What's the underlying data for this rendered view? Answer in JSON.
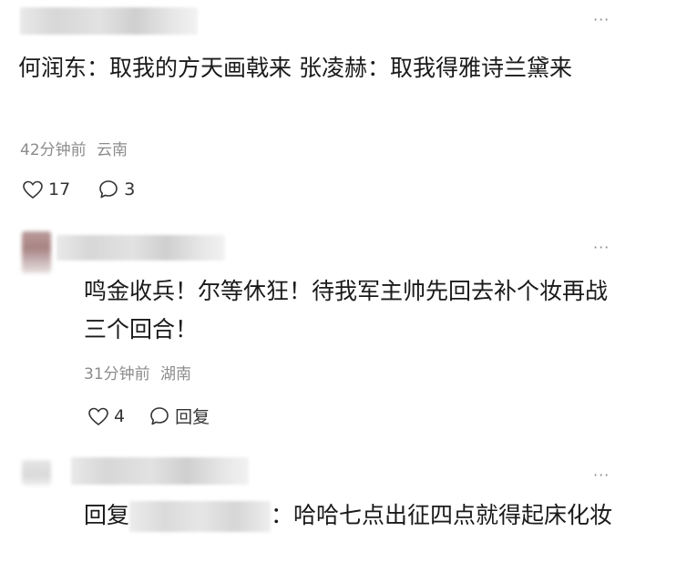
{
  "comments": [
    {
      "text": "何润东：取我的方天画戟来 张凌赫：取我得雅诗兰黛来",
      "time": "42分钟前",
      "location": "云南",
      "likes": "17",
      "replies": "3"
    },
    {
      "text": "鸣金收兵！尔等休狂！待我军主帅先回去补个妆再战三个回合！",
      "time": "31分钟前",
      "location": "湖南",
      "likes": "4",
      "reply_label": "回复"
    },
    {
      "reply_prefix": "回复",
      "text": "：哈哈七点出征四点就得起床化妆"
    }
  ],
  "icons": {
    "more": "more-dots-icon",
    "like": "heart-outline-icon",
    "comment": "comment-bubble-icon"
  },
  "colors": {
    "text": "#1a1a1a",
    "meta": "#8c8c8c",
    "icon": "#333333"
  }
}
